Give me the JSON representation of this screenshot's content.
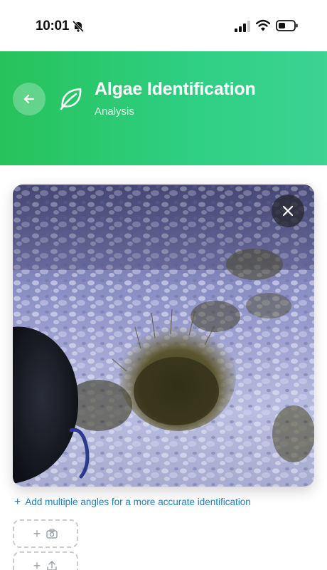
{
  "status_bar": {
    "time": "10:01",
    "icons": [
      "bell-off-icon",
      "cellular-signal-icon",
      "wifi-icon",
      "battery-icon"
    ]
  },
  "header": {
    "title": "Algae Identification",
    "subtitle": "Analysis",
    "back_icon": "arrow-left-icon",
    "leaf_icon": "leaf-icon",
    "gradient_colors": [
      "#27c25a",
      "#3dd393"
    ]
  },
  "photo": {
    "close_icon": "close-icon"
  },
  "hint": {
    "plus": "+",
    "text": "Add multiple angles for a more accurate identification",
    "color": "#1f7fb8"
  },
  "add_slots": [
    {
      "plus": "+",
      "icon": "camera-icon"
    },
    {
      "plus": "+",
      "icon": "upload-icon"
    }
  ]
}
